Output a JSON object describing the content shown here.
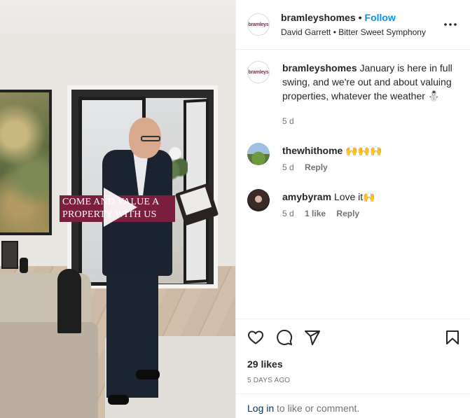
{
  "video": {
    "overlay_text": "COME AND VALUE A PROPERTY WITH US"
  },
  "header": {
    "username": "bramleyshomes",
    "separator": "•",
    "follow_label": "Follow",
    "audio_text": "David Garrett • Bitter Sweet Symphony",
    "avatar_logo": "bramleys"
  },
  "caption": {
    "username": "bramleyshomes",
    "text": "January is here in full swing, and we're out and about valuing properties, whatever the weather",
    "emoji": "⛄",
    "time": "5 d",
    "avatar_logo": "bramleys"
  },
  "comments": [
    {
      "username": "thewhithome",
      "text": "",
      "emoji": "🙌🙌🙌",
      "time": "5 d",
      "likes": "",
      "reply_label": "Reply"
    },
    {
      "username": "amybyram",
      "text": "Love it",
      "emoji": "🙌",
      "time": "5 d",
      "likes": "1 like",
      "reply_label": "Reply"
    }
  ],
  "footer": {
    "likes": "29 likes",
    "posted_ago": "5 DAYS AGO",
    "login_link": "Log in",
    "login_rest": " to like or comment."
  },
  "icons": {
    "like": "heart-icon",
    "comment": "comment-icon",
    "share": "share-icon",
    "save": "bookmark-icon",
    "more": "more-options-icon",
    "play": "play-icon"
  }
}
